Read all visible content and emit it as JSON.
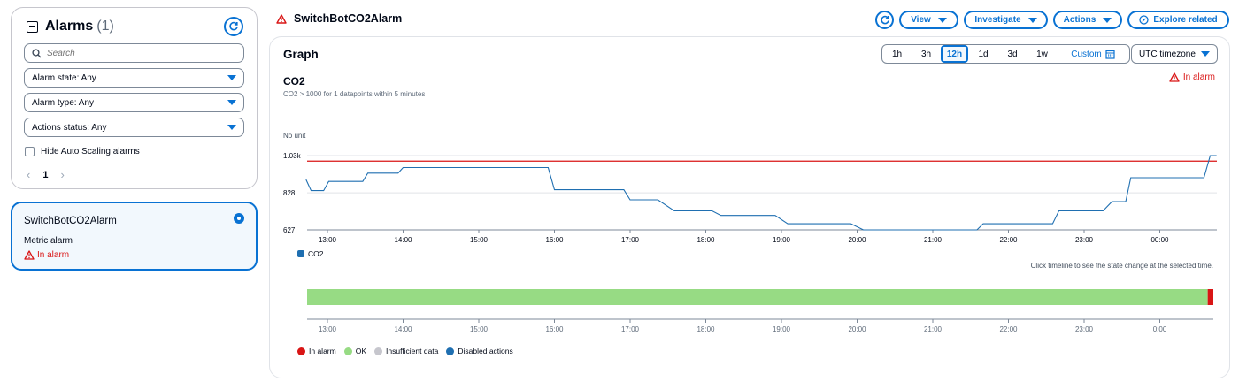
{
  "sidebar": {
    "title": "Alarms",
    "count": "(1)",
    "search_placeholder": "Search",
    "filters": [
      {
        "label": "Alarm state: Any"
      },
      {
        "label": "Alarm type: Any"
      },
      {
        "label": "Actions status: Any"
      }
    ],
    "hide_autoscaling_label": "Hide Auto Scaling alarms",
    "current_page": "1"
  },
  "alarm_card": {
    "name": "SwitchBotCO2Alarm",
    "type": "Metric alarm",
    "state": "In alarm"
  },
  "header": {
    "title": "SwitchBotCO2Alarm",
    "buttons": {
      "view": "View",
      "investigate": "Investigate",
      "actions": "Actions",
      "explore": "Explore related"
    }
  },
  "graph": {
    "title": "Graph",
    "ranges": [
      "1h",
      "3h",
      "12h",
      "1d",
      "3d",
      "1w"
    ],
    "active_range": "12h",
    "custom_label": "Custom",
    "timezone": "UTC timezone",
    "metric_name": "CO2",
    "condition": "CO2 > 1000 for 1 datapoints within 5 minutes",
    "alarm_state": "In alarm",
    "unit": "No unit",
    "series_legend": "CO2",
    "timeline_hint": "Click timeline to see the state change at the selected time.",
    "state_legend": [
      {
        "label": "In alarm",
        "color": "#d91515"
      },
      {
        "label": "OK",
        "color": "#97db84"
      },
      {
        "label": "Insufficient data",
        "color": "#c6c6cd"
      },
      {
        "label": "Disabled actions",
        "color": "#1f6fb1"
      }
    ]
  },
  "chart_data": {
    "type": "line",
    "xlabel": "",
    "ylabel": "No unit",
    "x_ticks": [
      "13:00",
      "14:00",
      "15:00",
      "16:00",
      "17:00",
      "18:00",
      "19:00",
      "20:00",
      "21:00",
      "22:00",
      "23:00",
      "00:00"
    ],
    "timeline_ticks": [
      "13:00",
      "14:00",
      "15:00",
      "16:00",
      "17:00",
      "18:00",
      "19:00",
      "20:00",
      "21:00",
      "22:00",
      "23:00",
      "0:00"
    ],
    "y_ticks": [
      "627",
      "828",
      "1.03k"
    ],
    "ylim": [
      627,
      1030
    ],
    "threshold": 1000,
    "series": [
      {
        "name": "CO2",
        "color": "#1f6fb1",
        "points": [
          [
            "12:43",
            900
          ],
          [
            "12:47",
            840
          ],
          [
            "12:57",
            840
          ],
          [
            "13:01",
            890
          ],
          [
            "13:14",
            890
          ],
          [
            "13:28",
            890
          ],
          [
            "13:32",
            935
          ],
          [
            "13:56",
            935
          ],
          [
            "14:00",
            965
          ],
          [
            "15:55",
            965
          ],
          [
            "16:00",
            845
          ],
          [
            "16:55",
            845
          ],
          [
            "17:00",
            790
          ],
          [
            "17:22",
            790
          ],
          [
            "17:35",
            730
          ],
          [
            "18:05",
            730
          ],
          [
            "18:12",
            705
          ],
          [
            "18:55",
            705
          ],
          [
            "19:05",
            660
          ],
          [
            "19:55",
            660
          ],
          [
            "20:05",
            627
          ],
          [
            "21:35",
            627
          ],
          [
            "21:40",
            660
          ],
          [
            "22:05",
            660
          ],
          [
            "22:35",
            660
          ],
          [
            "22:40",
            730
          ],
          [
            "23:15",
            730
          ],
          [
            "23:22",
            780
          ],
          [
            "23:33",
            780
          ],
          [
            "23:37",
            910
          ],
          [
            "00:35",
            910
          ],
          [
            "00:40",
            1030
          ],
          [
            "00:45",
            1030
          ]
        ]
      }
    ],
    "state_timeline": [
      {
        "state": "OK",
        "from": "12:43",
        "to": "00:38"
      },
      {
        "state": "In alarm",
        "from": "00:38",
        "to": "00:45"
      }
    ]
  }
}
